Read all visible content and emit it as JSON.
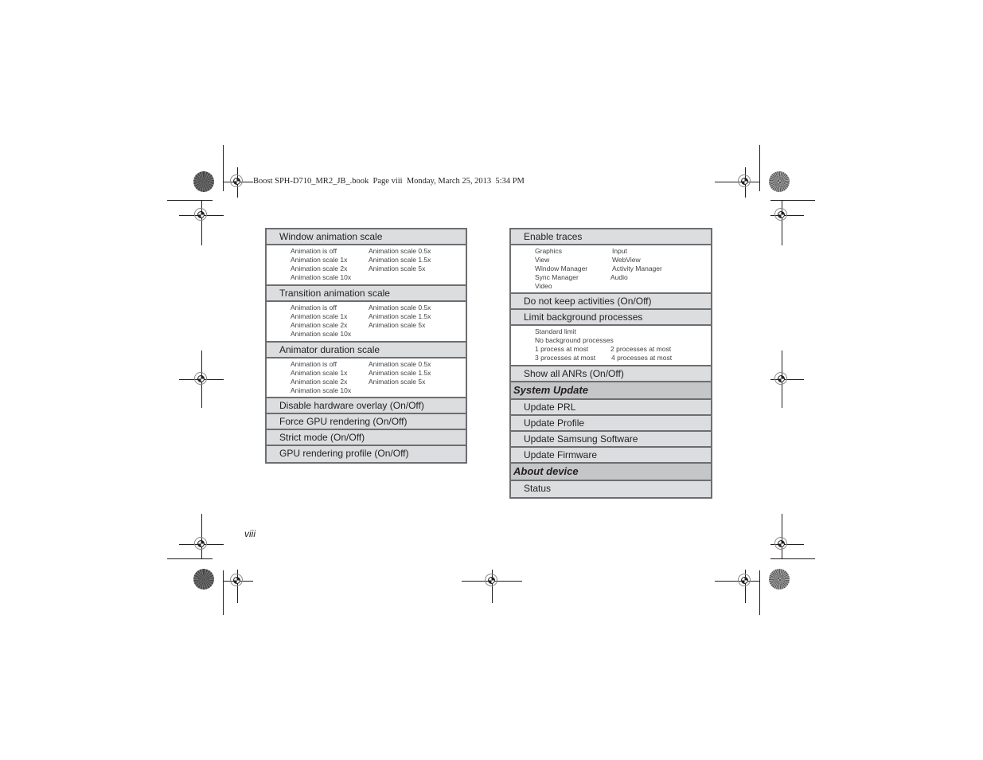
{
  "header": {
    "print_slug": "Boost SPH-D710_MR2_JB_.book  Page viii  Monday, March 25, 2013  5:34 PM"
  },
  "page_number": "viii",
  "left_table": {
    "window_animation": {
      "label": "Window animation scale",
      "options": [
        "Animation is off",
        "Animation scale 0.5x",
        "Animation scale 1x",
        "Animation scale 1.5x",
        "Animation scale 2x",
        "Animation scale 5x",
        "Animation scale 10x"
      ]
    },
    "transition_animation": {
      "label": "Transition animation scale",
      "options": [
        "Animation is off",
        "Animation scale 0.5x",
        "Animation scale 1x",
        "Animation scale 1.5x",
        "Animation scale 2x",
        "Animation scale 5x",
        "Animation scale 10x"
      ]
    },
    "animator_duration": {
      "label": "Animator duration scale",
      "options": [
        "Animation is off",
        "Animation scale 0.5x",
        "Animation scale 1x",
        "Animation scale 1.5x",
        "Animation scale 2x",
        "Animation scale 5x",
        "Animation scale 10x"
      ]
    },
    "rows": [
      "Disable hardware overlay (On/Off)",
      "Force GPU rendering (On/Off)",
      "Strict mode (On/Off)",
      "GPU rendering profile (On/Off)"
    ]
  },
  "right_table": {
    "enable_traces": {
      "label": "Enable traces",
      "options": [
        "Graphics",
        "Input",
        "View",
        "WebView",
        "Window Manager",
        "Activity Manager",
        "Sync Manager",
        "Audio",
        "Video"
      ]
    },
    "do_not_keep": "Do not keep activities (On/Off)",
    "limit_background": {
      "label": "Limit background processes",
      "options": [
        "Standard limit",
        "No background processes",
        "1 process at most",
        "2 processes at most",
        "3 processes at most",
        "4 processes at most"
      ]
    },
    "show_anrs": "Show all ANRs (On/Off)",
    "system_update": {
      "section": "System Update",
      "items": [
        "Update PRL",
        "Update Profile",
        "Update Samsung Software",
        "Update Firmware"
      ]
    },
    "about_device": {
      "section": "About device",
      "items": [
        "Status"
      ]
    }
  }
}
